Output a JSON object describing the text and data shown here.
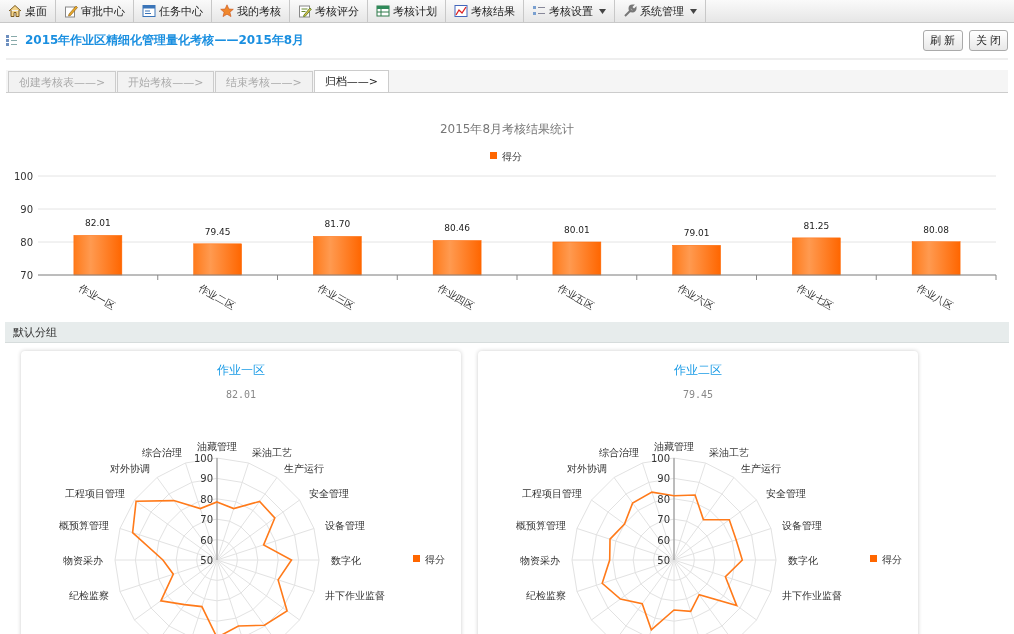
{
  "menu": [
    {
      "label": "桌面",
      "dropdown": false
    },
    {
      "label": "审批中心",
      "dropdown": false
    },
    {
      "label": "任务中心",
      "dropdown": false
    },
    {
      "label": "我的考核",
      "dropdown": false
    },
    {
      "label": "考核评分",
      "dropdown": false
    },
    {
      "label": "考核计划",
      "dropdown": false
    },
    {
      "label": "考核结果",
      "dropdown": false
    },
    {
      "label": "考核设置",
      "dropdown": true
    },
    {
      "label": "系统管理",
      "dropdown": true
    }
  ],
  "header": {
    "title": "2015年作业区精细化管理量化考核——2015年8月",
    "buttons": [
      "刷 新",
      "关 闭"
    ]
  },
  "steps": [
    {
      "label": "创建考核表——>",
      "selected": false
    },
    {
      "label": "开始考核——>",
      "selected": false
    },
    {
      "label": "结束考核——>",
      "selected": false
    },
    {
      "label": "归档——>",
      "selected": true
    }
  ],
  "summary": {
    "chart_data": {
      "type": "bar",
      "title": "2015年8月考核结果统计",
      "categories": [
        "作业一区",
        "作业二区",
        "作业三区",
        "作业四区",
        "作业五区",
        "作业六区",
        "作业七区",
        "作业八区"
      ],
      "series": [
        {
          "name": "得分",
          "color": "#ff6600",
          "values": [
            82.01,
            79.45,
            81.7,
            80.46,
            80.01,
            79.01,
            81.25,
            80.08
          ]
        }
      ],
      "ylim": [
        70,
        100
      ],
      "yticks": [
        70,
        80,
        90,
        100
      ],
      "value_labels": [
        "82.01",
        "79.45",
        "81.70",
        "80.46",
        "80.01",
        "79.01",
        "81.25",
        "80.08"
      ]
    }
  },
  "group": {
    "title": "默认分组",
    "cards": [
      {
        "title": "作业一区",
        "score": "82.01",
        "radar": {
          "axis_labels": [
            "油藏管理",
            "综合治理",
            "采油工艺",
            "对外协调",
            "生产运行",
            "工程项目管理",
            "安全管理",
            "概预算管理",
            "设备管理",
            "物资采办",
            "数字化",
            "纪检监察",
            "井下作业监督"
          ],
          "scale_labels": [
            "100",
            "90",
            "80",
            "70",
            "60",
            "50"
          ],
          "legend": "得分"
        }
      },
      {
        "title": "作业二区",
        "score": "79.45",
        "radar": {
          "axis_labels": [
            "油藏管理",
            "综合治理",
            "采油工艺",
            "对外协调",
            "生产运行",
            "工程项目管理",
            "安全管理",
            "概预算管理",
            "设备管理",
            "物资采办",
            "数字化",
            "纪检监察",
            "井下作业监督"
          ],
          "scale_labels": [
            "100",
            "90",
            "80",
            "70",
            "60",
            "50"
          ],
          "legend": "得分"
        }
      }
    ]
  }
}
